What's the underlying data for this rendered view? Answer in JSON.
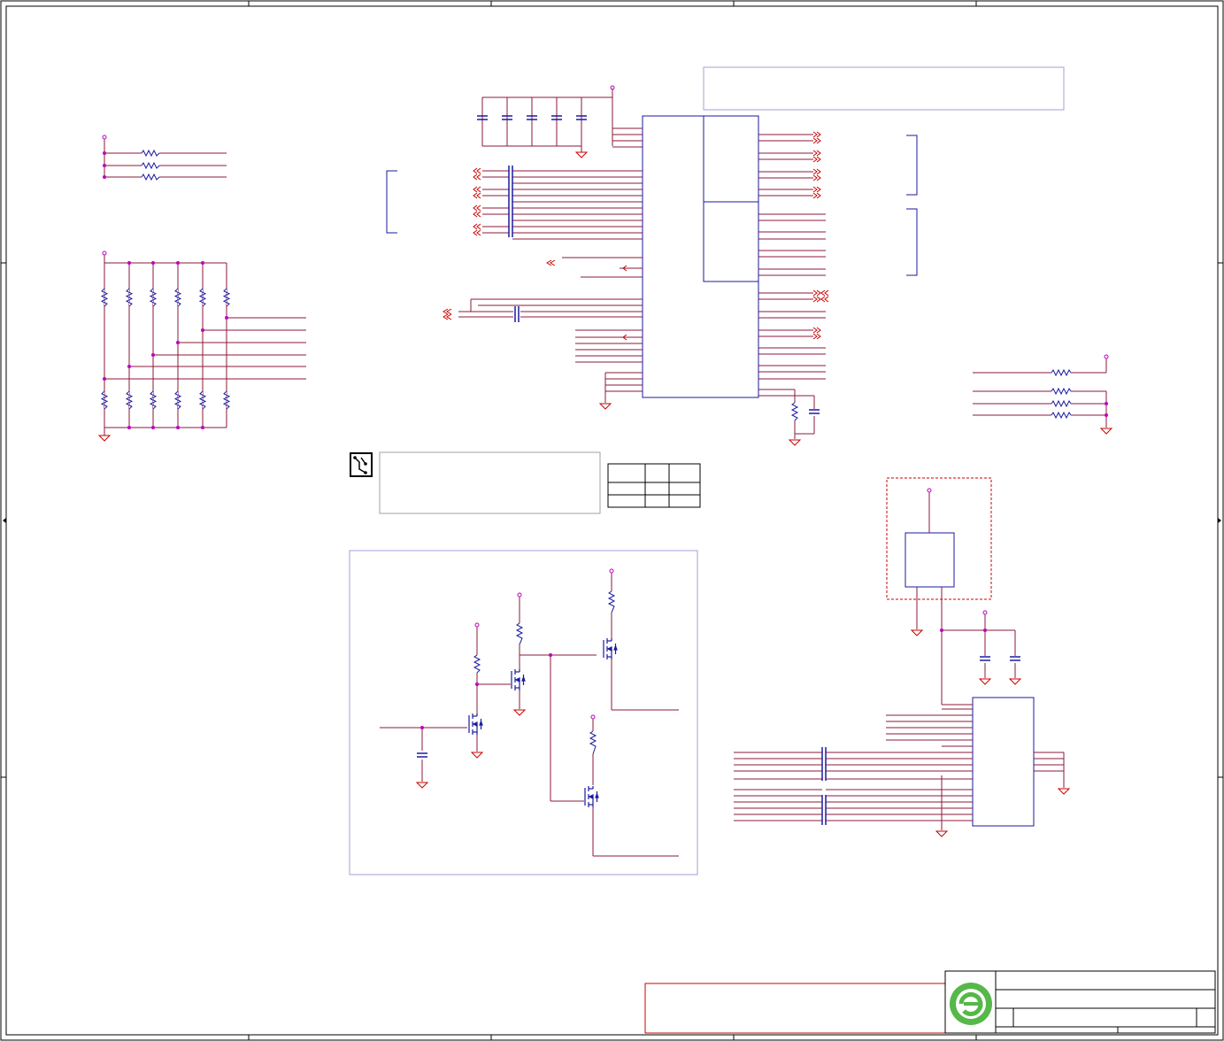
{
  "sheet": {
    "title": "",
    "colors": {
      "frame": "#000000",
      "wire": "#8b1a3a",
      "net_red": "#cc0000",
      "part_blue": "#1a1aa0",
      "note_border": "#9999cc",
      "logo_green": "#55b848",
      "junction": "#c000c0"
    }
  },
  "icons": {
    "pcb_note_icon": "circuit-board-icon",
    "logo": "company-logo-icon"
  }
}
